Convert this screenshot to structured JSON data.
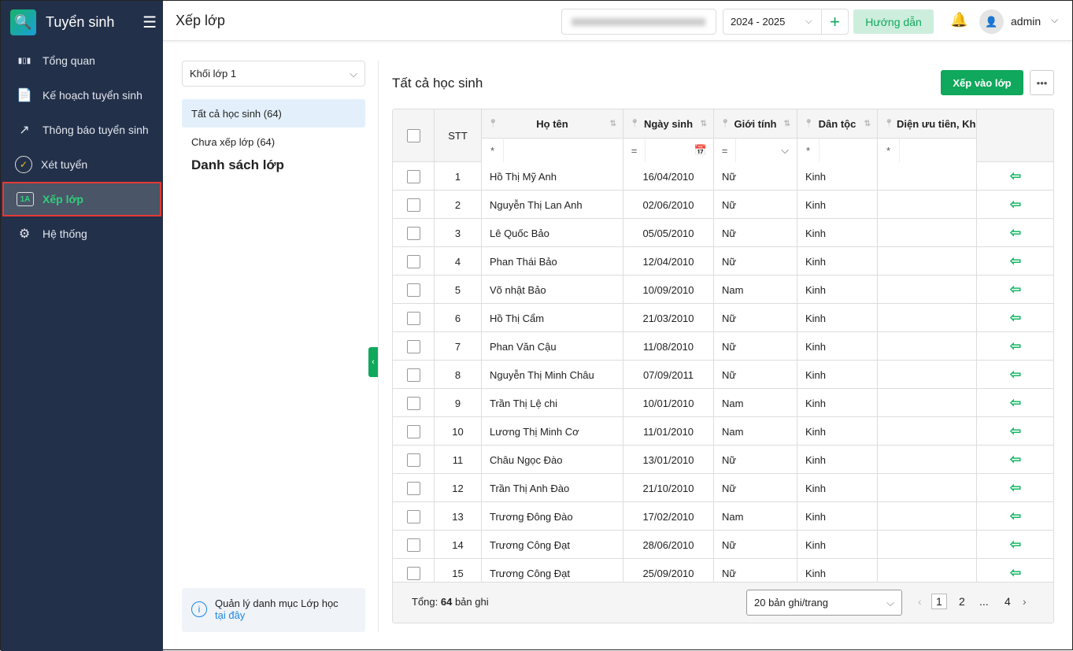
{
  "sidebar": {
    "title": "Tuyển sinh",
    "items": [
      {
        "label": "Tổng quan",
        "icon": "bar-chart-icon"
      },
      {
        "label": "Kế hoạch tuyển sinh",
        "icon": "document-icon"
      },
      {
        "label": "Thông báo tuyển sinh",
        "icon": "external-link-icon"
      },
      {
        "label": "Xét tuyển",
        "icon": "check-circle-icon"
      },
      {
        "label": "Xếp lớp",
        "icon": "class-1a-icon",
        "active": true,
        "badge": "1A"
      },
      {
        "label": "Hệ thống",
        "icon": "gear-icon"
      }
    ]
  },
  "header": {
    "title": "Xếp lớp",
    "school_year": "2024 - 2025",
    "guide_label": "Hướng dẫn",
    "user": "admin"
  },
  "left": {
    "grade_select": "Khối lớp 1",
    "tabs": [
      "Tất cả học sinh (64)",
      "Chưa xếp lớp (64)"
    ],
    "class_list_title": "Danh sách lớp",
    "info_text": "Quản lý danh mục Lớp học",
    "info_link": "tại đây"
  },
  "main": {
    "title": "Tất cả học sinh",
    "assign_button": "Xếp vào lớp",
    "more_button": "•••"
  },
  "table": {
    "columns": [
      "STT",
      "Họ tên",
      "Ngày sinh",
      "Giới tính",
      "Dân tộc",
      "Diện ưu tiên, Kh"
    ],
    "filters": [
      "*",
      "=",
      "=",
      "*",
      "*"
    ],
    "rows": [
      [
        "1",
        "Hồ Thị Mỹ Anh",
        "16/04/2010",
        "Nữ",
        "Kinh"
      ],
      [
        "2",
        "Nguyễn Thị Lan Anh",
        "02/06/2010",
        "Nữ",
        "Kinh"
      ],
      [
        "3",
        "Lê Quốc Bảo",
        "05/05/2010",
        "Nữ",
        "Kinh"
      ],
      [
        "4",
        "Phan Thái Bảo",
        "12/04/2010",
        "Nữ",
        "Kinh"
      ],
      [
        "5",
        "Võ nhật Bảo",
        "10/09/2010",
        "Nam",
        "Kinh"
      ],
      [
        "6",
        "Hồ Thị Cẩm",
        "21/03/2010",
        "Nữ",
        "Kinh"
      ],
      [
        "7",
        "Phan Văn Cậu",
        "11/08/2010",
        "Nữ",
        "Kinh"
      ],
      [
        "8",
        "Nguyễn Thị Minh Châu",
        "07/09/2011",
        "Nữ",
        "Kinh"
      ],
      [
        "9",
        "Trần Thị Lệ chi",
        "10/01/2010",
        "Nam",
        "Kinh"
      ],
      [
        "10",
        "Lương Thị Minh Cơ",
        "11/01/2010",
        "Nam",
        "Kinh"
      ],
      [
        "11",
        "Châu Ngọc Đào",
        "13/01/2010",
        "Nữ",
        "Kinh"
      ],
      [
        "12",
        "Trần Thị Anh Đào",
        "21/10/2010",
        "Nữ",
        "Kinh"
      ],
      [
        "13",
        "Trương Đông Đào",
        "17/02/2010",
        "Nam",
        "Kinh"
      ],
      [
        "14",
        "Trương Công Đạt",
        "28/06/2010",
        "Nữ",
        "Kinh"
      ],
      [
        "15",
        "Trương Công Đạt",
        "25/09/2010",
        "Nữ",
        "Kinh"
      ]
    ]
  },
  "footer": {
    "total_prefix": "Tổng: ",
    "total": "64",
    "total_suffix": " bản ghi",
    "page_size": "20 bản ghi/trang",
    "pages": [
      "1",
      "2",
      "...",
      "4"
    ]
  }
}
